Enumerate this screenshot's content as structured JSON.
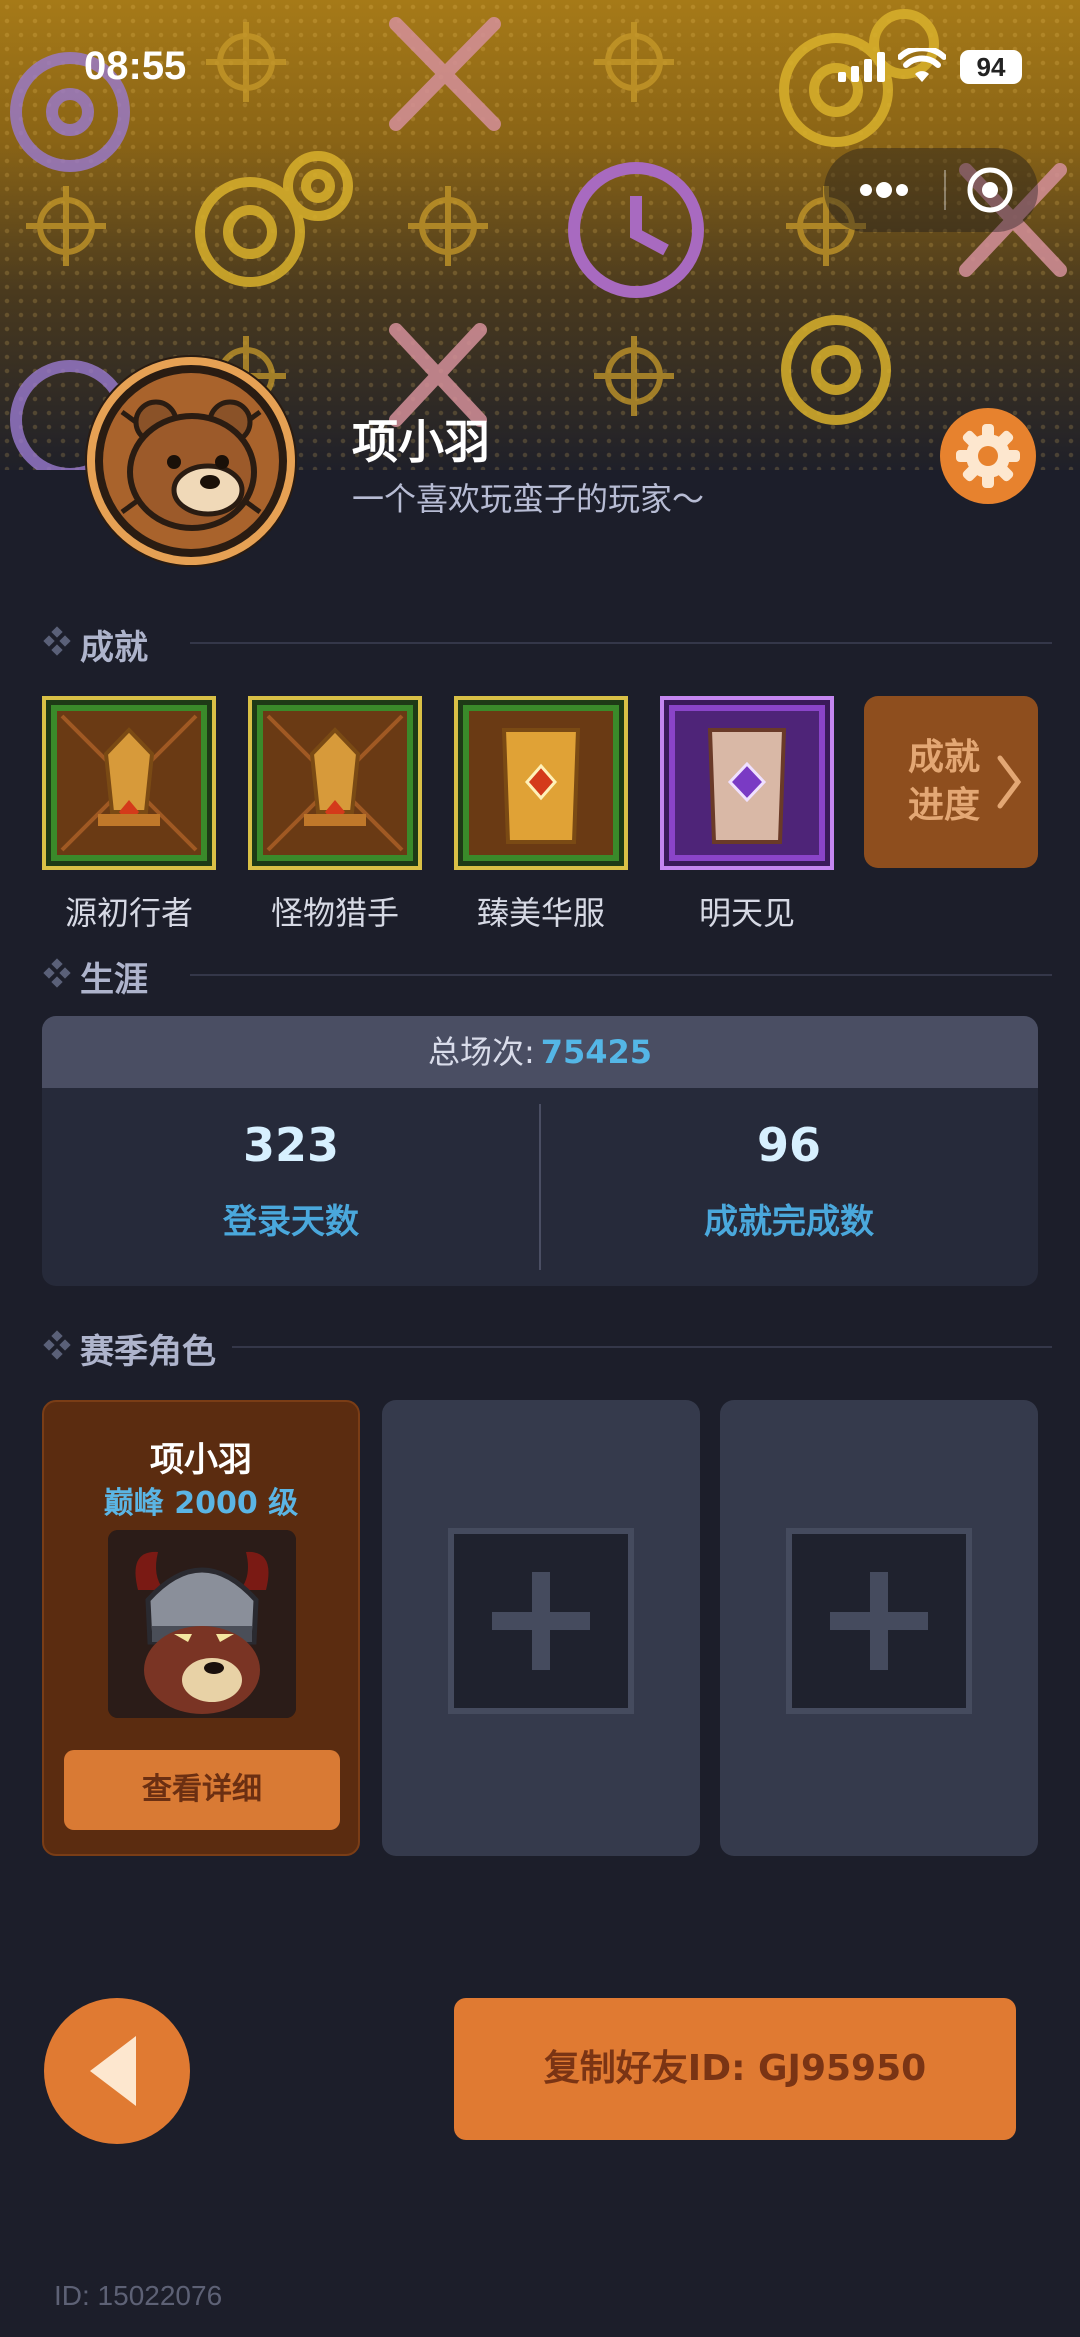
{
  "status_bar": {
    "time": "08:55",
    "battery": "94"
  },
  "profile": {
    "nickname": "项小羽",
    "signature": "一个喜欢玩蛮子的玩家～",
    "avatar_icon": "bear-avatar-icon",
    "settings_icon": "gear-icon"
  },
  "achievements": {
    "title": "成就",
    "items": [
      {
        "label": "源初行者",
        "tier": "green"
      },
      {
        "label": "怪物猎手",
        "tier": "green"
      },
      {
        "label": "臻美华服",
        "tier": "green"
      },
      {
        "label": "明天见",
        "tier": "purple"
      }
    ],
    "progress_line1": "成就",
    "progress_line2": "进度"
  },
  "career": {
    "title": "生涯",
    "total_label": "总场次:",
    "total_value": "75425",
    "stats": [
      {
        "value": "323",
        "label": "登录天数"
      },
      {
        "value": "96",
        "label": "成就完成数"
      }
    ]
  },
  "season_roles": {
    "title": "赛季角色",
    "cards": [
      {
        "name": "项小羽",
        "level": "巅峰 2000 级",
        "button": "查看详细"
      }
    ]
  },
  "footer": {
    "copy_button": "复制好友ID: GJ95950",
    "user_id": "ID: 15022076"
  },
  "colors": {
    "accent": "#e07a32",
    "background": "#1c1e2a",
    "stat_blue": "#4aa8dc"
  }
}
